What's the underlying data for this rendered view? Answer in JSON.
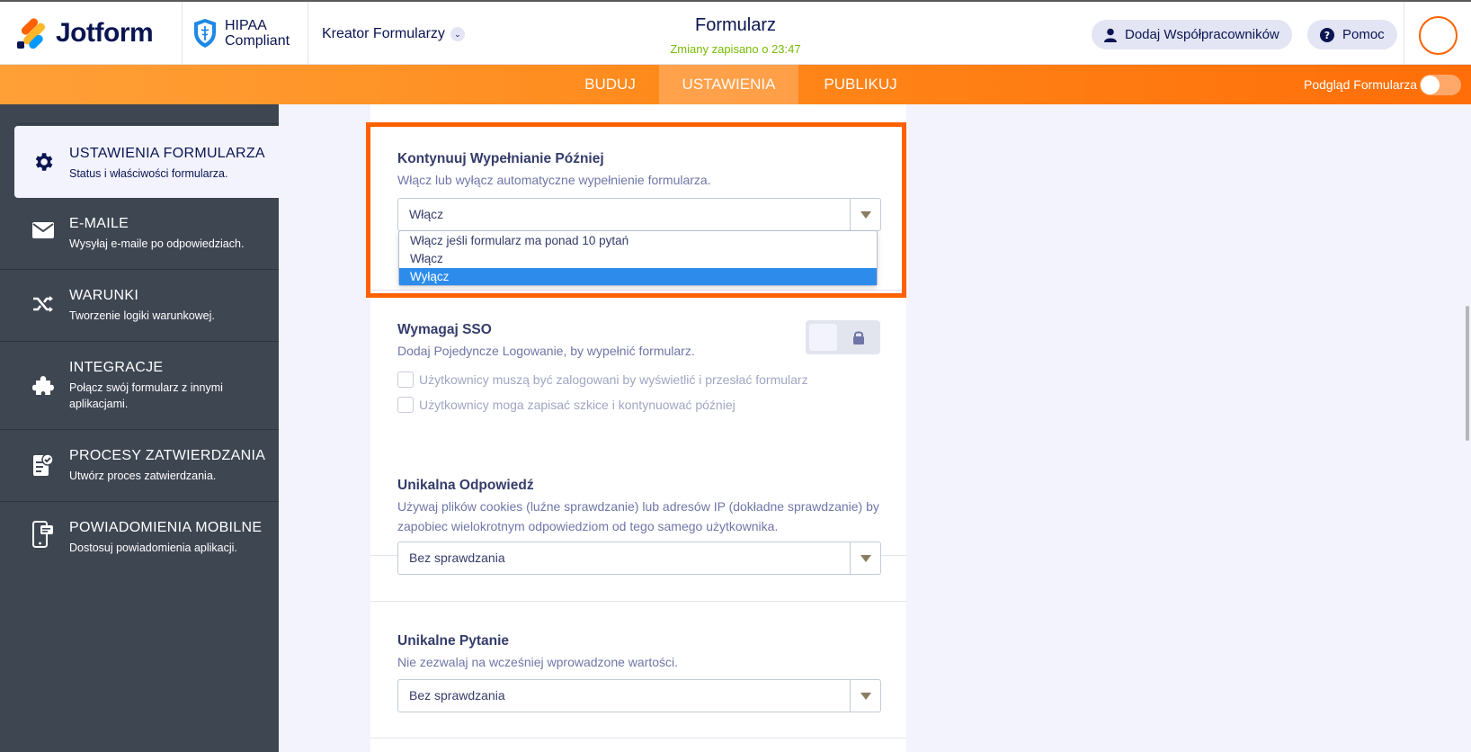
{
  "header": {
    "logo_text": "Jotform",
    "hipaa_line1": "HIPAA",
    "hipaa_line2": "Compliant",
    "creator_label": "Kreator Formularzy",
    "form_title": "Formularz",
    "saved_status": "Zmiany zapisano o 23:47",
    "collaborators_label": "Dodaj Współpracowników",
    "help_label": "Pomoc"
  },
  "nav": {
    "tabs": [
      {
        "label": "BUDUJ",
        "active": false
      },
      {
        "label": "USTAWIENIA",
        "active": true
      },
      {
        "label": "PUBLIKUJ",
        "active": false
      }
    ],
    "preview_label": "Podgląd Formularza"
  },
  "sidebar": {
    "items": [
      {
        "title": "USTAWIENIA FORMULARZA",
        "desc": "Status i właściwości formularza.",
        "icon": "gear-icon"
      },
      {
        "title": "E-MAILE",
        "desc": "Wysyłaj e-maile po odpowiedziach.",
        "icon": "envelope-icon"
      },
      {
        "title": "WARUNKI",
        "desc": "Tworzenie logiki warunkowej.",
        "icon": "shuffle-icon"
      },
      {
        "title": "INTEGRACJE",
        "desc": "Połącz swój formularz z innymi aplikacjami.",
        "icon": "puzzle-icon"
      },
      {
        "title": "PROCESY ZATWIERDZANIA",
        "desc": "Utwórz proces zatwierdzania.",
        "icon": "approval-icon"
      },
      {
        "title": "POWIADOMIENIA MOBILNE",
        "desc": "Dostosuj powiadomienia aplikacji.",
        "icon": "mobile-icon"
      }
    ]
  },
  "main": {
    "continue_later": {
      "title": "Kontynuuj Wypełnianie Później",
      "desc": "Włącz lub wyłącz automatyczne wypełnienie formularza.",
      "value": "Włącz",
      "options": [
        "Włącz jeśli formularz ma ponad 10 pytań",
        "Włącz",
        "Wyłącz"
      ],
      "highlighted_option": "Wyłącz"
    },
    "sso": {
      "title": "Wymagaj SSO",
      "desc": "Dodaj Pojedyncze Logowanie, by wypełnić formularz.",
      "checkbox1": "Użytkownicy muszą być zalogowani by wyświetlić i przesłać formularz",
      "checkbox2": "Użytkownicy moga zapisać szkice i kontynuować później"
    },
    "unique_response": {
      "title": "Unikalna Odpowiedź",
      "desc": "Używaj plików cookies (luźne sprawdzanie) lub adresów IP (dokładne sprawdzanie) by zapobiec wielokrotnym odpowiedziom od tego samego użytkownika.",
      "value": "Bez sprawdzania"
    },
    "unique_question": {
      "title": "Unikalne Pytanie",
      "desc": "Nie zezwalaj na wcześniej wprowadzone wartości.",
      "value": "Bez sprawdzania"
    }
  },
  "colors": {
    "accent_orange": "#ff6100",
    "selected_blue": "#2d8ceb",
    "sidebar_bg": "#3e4652",
    "saved_green": "#78bb07"
  }
}
